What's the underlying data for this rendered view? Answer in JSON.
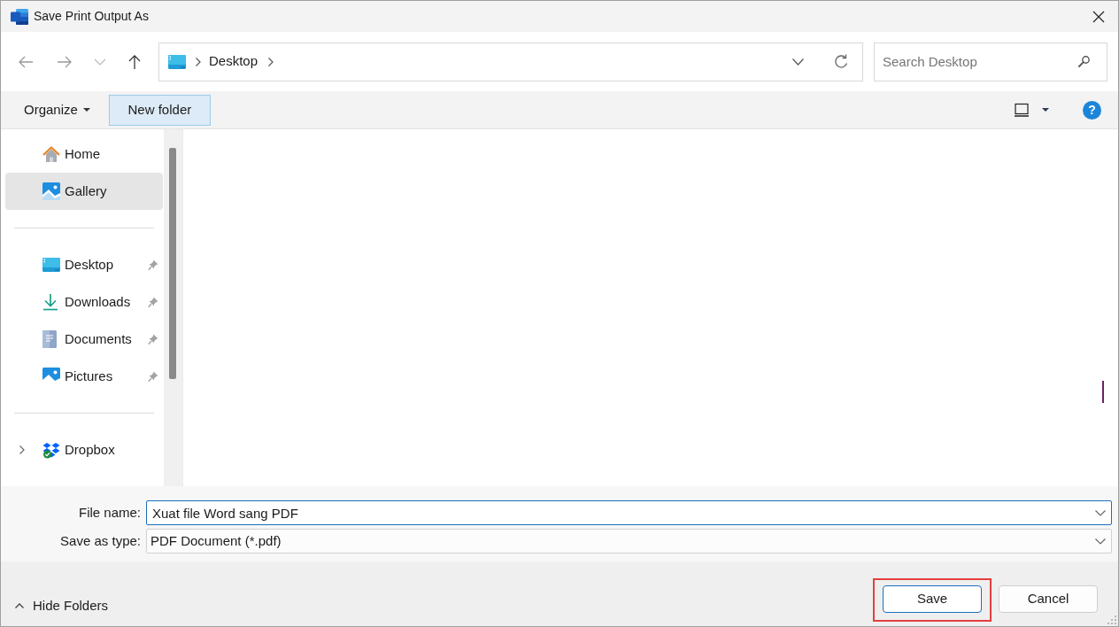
{
  "window": {
    "title": "Save Print Output As"
  },
  "navigation": {
    "buttons": [
      {
        "disabled": true
      },
      {
        "disabled": true
      },
      {
        "disabled": true
      },
      {
        "disabled": false
      }
    ],
    "address": {
      "path": [
        "Desktop"
      ]
    },
    "search": {
      "placeholder": "Search Desktop"
    }
  },
  "toolbar": {
    "items": [
      {
        "label": "Organize",
        "kind": "menu",
        "hovered": false
      },
      {
        "label": "New folder",
        "kind": "button",
        "hovered": true
      }
    ],
    "help": "?"
  },
  "sidebar": {
    "groups": [
      [
        {
          "label": "Home",
          "selected": false
        },
        {
          "label": "Gallery",
          "selected": true
        }
      ],
      [
        {
          "label": "Desktop",
          "selected": false,
          "pinned": true
        },
        {
          "label": "Downloads",
          "selected": false,
          "pinned": true
        },
        {
          "label": "Documents",
          "selected": false,
          "pinned": true
        },
        {
          "label": "Pictures",
          "selected": false,
          "pinned": true
        }
      ],
      [
        {
          "label": "Dropbox",
          "selected": false,
          "expanded": false
        }
      ]
    ]
  },
  "form": {
    "fields": [
      {
        "label": "File name:",
        "value": "Xuat file Word sang PDF",
        "kind": "combo",
        "focused": true
      },
      {
        "label": "Save as type:",
        "value": "PDF Document (*.pdf)",
        "kind": "dropdown",
        "focused": false
      }
    ]
  },
  "footer": {
    "hide_folders": "Hide Folders",
    "buttons": [
      {
        "label": "Save",
        "default": true,
        "highlighted": true
      },
      {
        "label": "Cancel",
        "default": false,
        "highlighted": false
      }
    ]
  }
}
